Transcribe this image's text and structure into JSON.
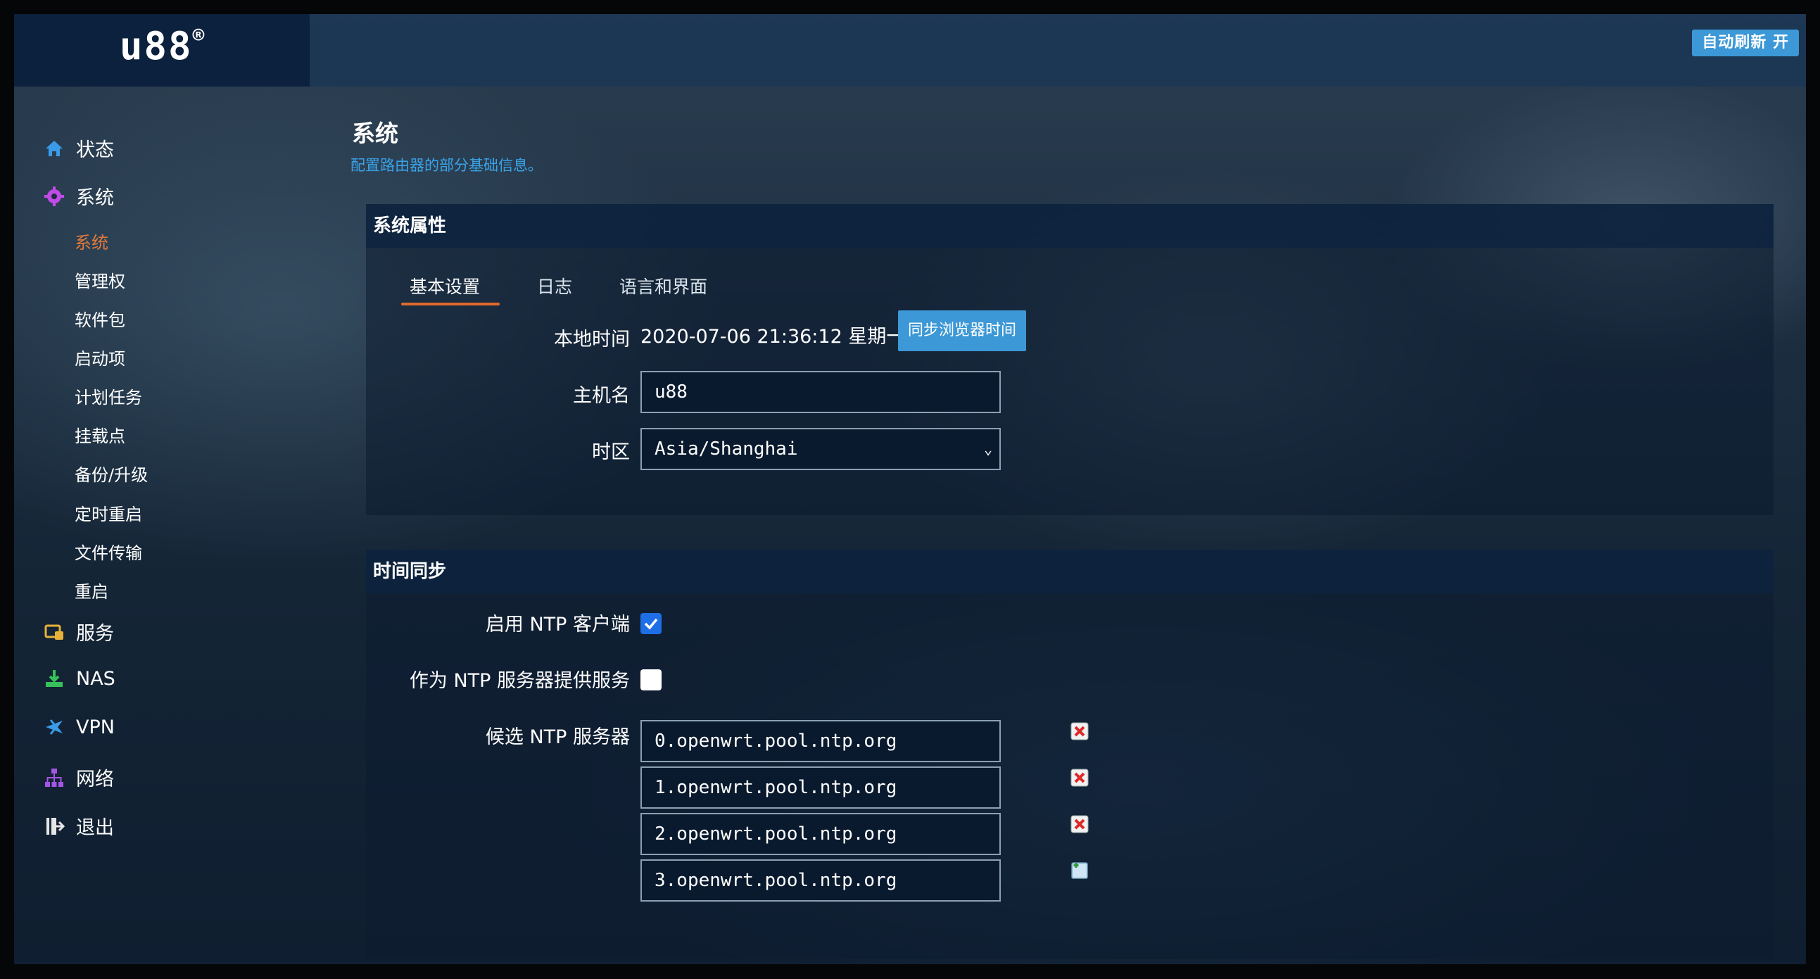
{
  "header": {
    "brand": "u88",
    "brand_mark": "®",
    "auto_refresh": "自动刷新 开"
  },
  "sidebar": {
    "top_items": [
      {
        "label": "状态",
        "icon": "home-icon"
      },
      {
        "label": "系统",
        "icon": "gear-icon"
      },
      {
        "label": "服务",
        "icon": "services-icon"
      },
      {
        "label": "NAS",
        "icon": "nas-icon"
      },
      {
        "label": "VPN",
        "icon": "vpn-icon"
      },
      {
        "label": "网络",
        "icon": "network-icon"
      },
      {
        "label": "退出",
        "icon": "logout-icon"
      }
    ],
    "sub_items": [
      {
        "label": "系统",
        "active": true
      },
      {
        "label": "管理权"
      },
      {
        "label": "软件包"
      },
      {
        "label": "启动项"
      },
      {
        "label": "计划任务"
      },
      {
        "label": "挂载点"
      },
      {
        "label": "备份/升级"
      },
      {
        "label": "定时重启"
      },
      {
        "label": "文件传输"
      },
      {
        "label": "重启"
      }
    ]
  },
  "page": {
    "title": "系统",
    "description": "配置路由器的部分基础信息。"
  },
  "system_properties": {
    "heading": "系统属性",
    "tabs": [
      {
        "label": "基本设置",
        "active": true
      },
      {
        "label": "日志"
      },
      {
        "label": "语言和界面"
      }
    ],
    "local_time_label": "本地时间",
    "local_time_value": "2020-07-06 21:36:12 星期一",
    "sync_button": "同步浏览器时间",
    "hostname_label": "主机名",
    "hostname_value": "u88",
    "timezone_label": "时区",
    "timezone_value": "Asia/Shanghai"
  },
  "time_sync": {
    "heading": "时间同步",
    "enable_ntp_label": "启用 NTP 客户端",
    "enable_ntp_checked": true,
    "ntp_server_label": "作为 NTP 服务器提供服务",
    "ntp_server_checked": false,
    "candidates_label": "候选 NTP 服务器",
    "servers": [
      "0.openwrt.pool.ntp.org",
      "1.openwrt.pool.ntp.org",
      "2.openwrt.pool.ntp.org",
      "3.openwrt.pool.ntp.org"
    ]
  },
  "colors": {
    "accent": "#3c98d6",
    "active_orange": "#e07a3a",
    "sidebar_dark": "#0c213d"
  }
}
